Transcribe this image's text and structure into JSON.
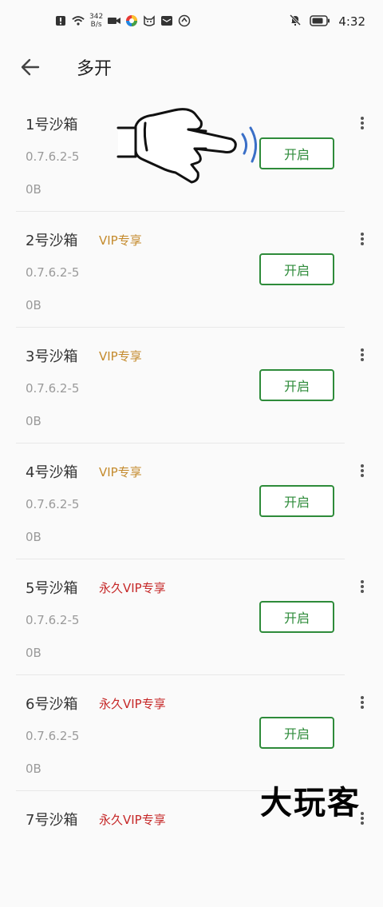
{
  "status_bar": {
    "net_speed_value": "342",
    "net_speed_unit": "B/s",
    "time": "4:32",
    "icons": [
      "alert-icon",
      "wifi-icon",
      "video-icon",
      "app-icon",
      "cat-icon",
      "message-icon",
      "browser-icon",
      "mute-icon",
      "battery-icon"
    ]
  },
  "header": {
    "title": "多开"
  },
  "sandboxes": [
    {
      "name": "1号沙箱",
      "tag": "",
      "version": "0.7.6.2-5",
      "size": "0B",
      "button": "开启"
    },
    {
      "name": "2号沙箱",
      "tag": "VIP专享",
      "tag_type": "vip",
      "version": "0.7.6.2-5",
      "size": "0B",
      "button": "开启"
    },
    {
      "name": "3号沙箱",
      "tag": "VIP专享",
      "tag_type": "vip",
      "version": "0.7.6.2-5",
      "size": "0B",
      "button": "开启"
    },
    {
      "name": "4号沙箱",
      "tag": "VIP专享",
      "tag_type": "vip",
      "version": "0.7.6.2-5",
      "size": "0B",
      "button": "开启"
    },
    {
      "name": "5号沙箱",
      "tag": "永久VIP专享",
      "tag_type": "perm",
      "version": "0.7.6.2-5",
      "size": "0B",
      "button": "开启"
    },
    {
      "name": "6号沙箱",
      "tag": "永久VIP专享",
      "tag_type": "perm",
      "version": "0.7.6.2-5",
      "size": "0B",
      "button": "开启"
    },
    {
      "name": "7号沙箱",
      "tag": "永久VIP专享",
      "tag_type": "perm",
      "version": "",
      "size": "",
      "button": ""
    }
  ],
  "watermark": "大玩客",
  "colors": {
    "accent_green": "#2e8b3a",
    "vip_gold": "#c48a2c",
    "perm_red": "#c62828"
  }
}
